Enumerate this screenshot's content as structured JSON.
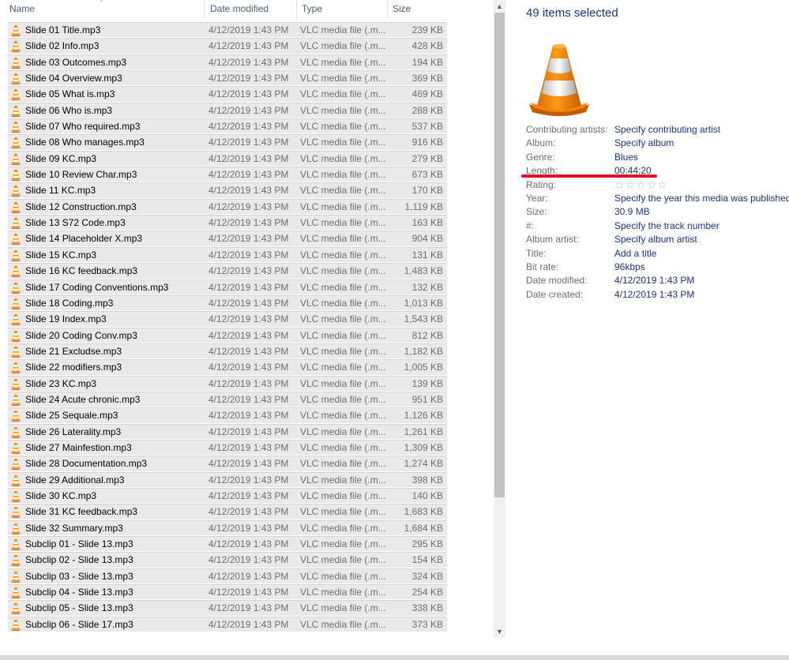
{
  "columns": {
    "name": "Name",
    "date_modified": "Date modified",
    "type": "Type",
    "size": "Size"
  },
  "files": [
    {
      "name": "Slide 01 Title.mp3",
      "date": "4/12/2019 1:43 PM",
      "type": "VLC media file (.m...",
      "size": "239 KB"
    },
    {
      "name": "Slide 02 Info.mp3",
      "date": "4/12/2019 1:43 PM",
      "type": "VLC media file (.m...",
      "size": "428 KB"
    },
    {
      "name": "Slide 03 Outcomes.mp3",
      "date": "4/12/2019 1:43 PM",
      "type": "VLC media file (.m...",
      "size": "194 KB"
    },
    {
      "name": "Slide 04 Overview.mp3",
      "date": "4/12/2019 1:43 PM",
      "type": "VLC media file (.m...",
      "size": "369 KB"
    },
    {
      "name": "Slide 05 What is.mp3",
      "date": "4/12/2019 1:43 PM",
      "type": "VLC media file (.m...",
      "size": "469 KB"
    },
    {
      "name": "Slide 06 Who is.mp3",
      "date": "4/12/2019 1:43 PM",
      "type": "VLC media file (.m...",
      "size": "288 KB"
    },
    {
      "name": "Slide 07 Who required.mp3",
      "date": "4/12/2019 1:43 PM",
      "type": "VLC media file (.m...",
      "size": "537 KB"
    },
    {
      "name": "Slide 08  Who manages.mp3",
      "date": "4/12/2019 1:43 PM",
      "type": "VLC media file (.m...",
      "size": "916 KB"
    },
    {
      "name": "Slide 09 KC.mp3",
      "date": "4/12/2019 1:43 PM",
      "type": "VLC media file (.m...",
      "size": "279 KB"
    },
    {
      "name": "Slide 10 Review Char.mp3",
      "date": "4/12/2019 1:43 PM",
      "type": "VLC media file (.m...",
      "size": "673 KB"
    },
    {
      "name": "Slide 11 KC.mp3",
      "date": "4/12/2019 1:43 PM",
      "type": "VLC media file (.m...",
      "size": "170 KB"
    },
    {
      "name": "Slide 12 Construction.mp3",
      "date": "4/12/2019 1:43 PM",
      "type": "VLC media file (.m...",
      "size": "1,119 KB"
    },
    {
      "name": "Slide 13 S72 Code.mp3",
      "date": "4/12/2019 1:43 PM",
      "type": "VLC media file (.m...",
      "size": "163 KB"
    },
    {
      "name": "Slide 14 Placeholder X.mp3",
      "date": "4/12/2019 1:43 PM",
      "type": "VLC media file (.m...",
      "size": "904 KB"
    },
    {
      "name": "Slide 15 KC.mp3",
      "date": "4/12/2019 1:43 PM",
      "type": "VLC media file (.m...",
      "size": "131 KB"
    },
    {
      "name": "Slide 16 KC feedback.mp3",
      "date": "4/12/2019 1:43 PM",
      "type": "VLC media file (.m...",
      "size": "1,483 KB"
    },
    {
      "name": "Slide 17 Coding Conventions.mp3",
      "date": "4/12/2019 1:43 PM",
      "type": "VLC media file (.m...",
      "size": "132 KB"
    },
    {
      "name": "Slide 18 Coding.mp3",
      "date": "4/12/2019 1:43 PM",
      "type": "VLC media file (.m...",
      "size": "1,013 KB"
    },
    {
      "name": "Slide 19 Index.mp3",
      "date": "4/12/2019 1:43 PM",
      "type": "VLC media file (.m...",
      "size": "1,543 KB"
    },
    {
      "name": "Slide 20 Coding Conv.mp3",
      "date": "4/12/2019 1:43 PM",
      "type": "VLC media file (.m...",
      "size": "812 KB"
    },
    {
      "name": "Slide 21 Excludse.mp3",
      "date": "4/12/2019 1:43 PM",
      "type": "VLC media file (.m...",
      "size": "1,182 KB"
    },
    {
      "name": "Slide 22 modifiers.mp3",
      "date": "4/12/2019 1:43 PM",
      "type": "VLC media file (.m...",
      "size": "1,005 KB"
    },
    {
      "name": "Slide 23 KC.mp3",
      "date": "4/12/2019 1:43 PM",
      "type": "VLC media file (.m...",
      "size": "139 KB"
    },
    {
      "name": "Slide 24 Acute chronic.mp3",
      "date": "4/12/2019 1:43 PM",
      "type": "VLC media file (.m...",
      "size": "951 KB"
    },
    {
      "name": "Slide 25 Sequale.mp3",
      "date": "4/12/2019 1:43 PM",
      "type": "VLC media file (.m...",
      "size": "1,126 KB"
    },
    {
      "name": "Slide 26 Laterality.mp3",
      "date": "4/12/2019 1:43 PM",
      "type": "VLC media file (.m...",
      "size": "1,261 KB"
    },
    {
      "name": "Slide 27 Mainfestion.mp3",
      "date": "4/12/2019 1:43 PM",
      "type": "VLC media file (.m...",
      "size": "1,309 KB"
    },
    {
      "name": "Slide 28 Documentation.mp3",
      "date": "4/12/2019 1:43 PM",
      "type": "VLC media file (.m...",
      "size": "1,274 KB"
    },
    {
      "name": "Slide 29 Additional.mp3",
      "date": "4/12/2019 1:43 PM",
      "type": "VLC media file (.m...",
      "size": "398 KB"
    },
    {
      "name": "Slide 30 KC.mp3",
      "date": "4/12/2019 1:43 PM",
      "type": "VLC media file (.m...",
      "size": "140 KB"
    },
    {
      "name": "Slide 31 KC feedback.mp3",
      "date": "4/12/2019 1:43 PM",
      "type": "VLC media file (.m...",
      "size": "1,683 KB"
    },
    {
      "name": "Slide 32 Summary.mp3",
      "date": "4/12/2019 1:43 PM",
      "type": "VLC media file (.m...",
      "size": "1,684 KB"
    },
    {
      "name": "Subclip 01 - Slide 13.mp3",
      "date": "4/12/2019 1:43 PM",
      "type": "VLC media file (.m...",
      "size": "295 KB"
    },
    {
      "name": "Subclip 02 - Slide 13.mp3",
      "date": "4/12/2019 1:43 PM",
      "type": "VLC media file (.m...",
      "size": "154 KB"
    },
    {
      "name": "Subclip 03 - Slide 13.mp3",
      "date": "4/12/2019 1:43 PM",
      "type": "VLC media file (.m...",
      "size": "324 KB"
    },
    {
      "name": "Subclip 04 - Slide 13.mp3",
      "date": "4/12/2019 1:43 PM",
      "type": "VLC media file (.m...",
      "size": "254 KB"
    },
    {
      "name": "Subclip 05 - Slide 13.mp3",
      "date": "4/12/2019 1:43 PM",
      "type": "VLC media file (.m...",
      "size": "338 KB"
    },
    {
      "name": "Subclip 06 - Slide 17.mp3",
      "date": "4/12/2019 1:43 PM",
      "type": "VLC media file (.m...",
      "size": "373 KB"
    }
  ],
  "details": {
    "selected_count": "49 items selected",
    "properties": [
      {
        "label": "Contributing artists:",
        "value": "Specify contributing artist"
      },
      {
        "label": "Album:",
        "value": "Specify album"
      },
      {
        "label": "Genre:",
        "value": "Blues"
      },
      {
        "label": "Length:",
        "value": "00:44:20"
      },
      {
        "label": "Rating:",
        "value": "",
        "stars": 0,
        "stars_max": 5
      },
      {
        "label": "Year:",
        "value": "Specify the year this media was published"
      },
      {
        "label": "Size:",
        "value": "30.9 MB"
      },
      {
        "label": "#:",
        "value": "Specify the track number"
      },
      {
        "label": "Album artist:",
        "value": "Specify album artist"
      },
      {
        "label": "Title:",
        "value": "Add a title"
      },
      {
        "label": "Bit rate:",
        "value": "96kbps"
      },
      {
        "label": "Date modified:",
        "value": "4/12/2019 1:43 PM"
      },
      {
        "label": "Date created:",
        "value": "4/12/2019 1:43 PM"
      }
    ]
  },
  "icons": {
    "file_icon": "vlc-cone-icon",
    "preview_icon": "vlc-cone-large-icon",
    "scroll_up": "chevron-up-icon",
    "scroll_down": "chevron-down-icon"
  },
  "colors": {
    "selected_row": "#e9e9e9",
    "link_value": "#1e3287",
    "annotation_underline": "#e0102a",
    "vlc_orange": "#f08a00"
  }
}
